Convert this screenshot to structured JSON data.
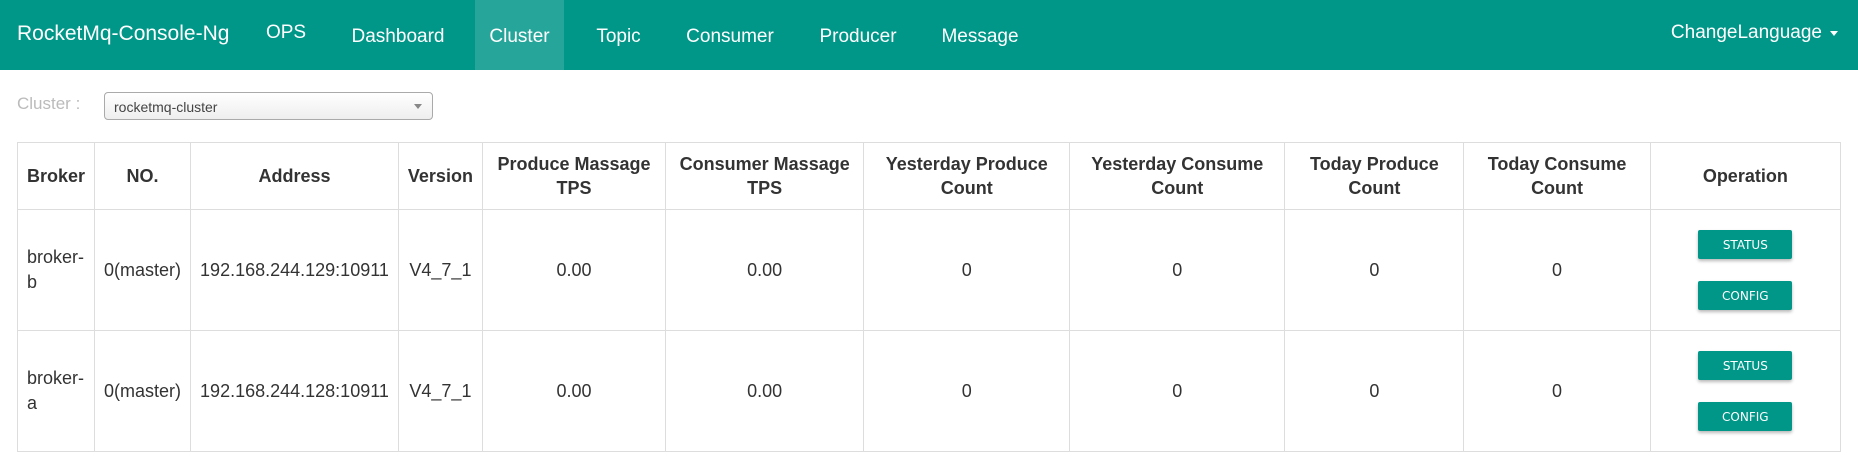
{
  "navbar": {
    "brand": "RocketMq-Console-Ng",
    "items": [
      {
        "label": "OPS"
      },
      {
        "label": "Dashboard"
      },
      {
        "label": "Cluster"
      },
      {
        "label": "Topic"
      },
      {
        "label": "Consumer"
      },
      {
        "label": "Producer"
      },
      {
        "label": "Message"
      }
    ],
    "active": "Cluster",
    "language_label": "ChangeLanguage",
    "background_color": "#009688"
  },
  "filter": {
    "cluster_label": "Cluster :",
    "cluster_value": "rocketmq-cluster"
  },
  "table": {
    "headers": [
      "Broker",
      "NO.",
      "Address",
      "Version",
      "Produce Massage TPS",
      "Consumer Massage TPS",
      "Yesterday Produce Count",
      "Yesterday Consume Count",
      "Today Produce Count",
      "Today Consume Count",
      "Operation"
    ],
    "rows": [
      {
        "broker": "broker-b",
        "no": "0(master)",
        "address": "192.168.244.129:10911",
        "version": "V4_7_1",
        "produce_tps": "0.00",
        "consumer_tps": "0.00",
        "yesterday_produce": "0",
        "yesterday_consume": "0",
        "today_produce": "0",
        "today_consume": "0"
      },
      {
        "broker": "broker-a",
        "no": "0(master)",
        "address": "192.168.244.128:10911",
        "version": "V4_7_1",
        "produce_tps": "0.00",
        "consumer_tps": "0.00",
        "yesterday_produce": "0",
        "yesterday_consume": "0",
        "today_produce": "0",
        "today_consume": "0"
      }
    ],
    "operations": {
      "status_label": "STATUS",
      "config_label": "CONFIG",
      "button_color": "#009688"
    }
  }
}
